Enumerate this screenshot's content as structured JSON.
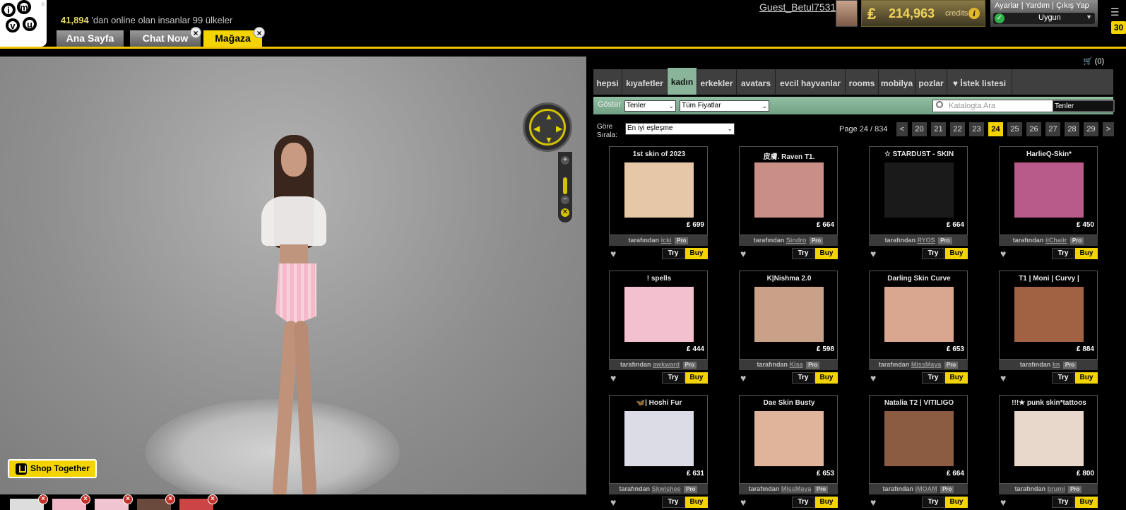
{
  "header": {
    "logo_letters": [
      "i",
      "m",
      "v",
      "u"
    ],
    "registered": "®",
    "online_count": "41,894",
    "online_text": " 'dan online olan insanlar 99 ülkeler",
    "username": "Guest_Betul7531",
    "credits_symbol": "₤",
    "credits_amount": "214,963",
    "credits_label": "credits",
    "info_glyph": "i",
    "links": [
      "Ayarlar",
      "Yardım",
      "Çıkış Yap"
    ],
    "link_separator": "|",
    "status": "Uygun",
    "menu_count": "30",
    "tabs": [
      {
        "label": "Ana Sayfa",
        "closable": false,
        "active": false
      },
      {
        "label": "Chat Now",
        "closable": true,
        "active": false
      },
      {
        "label": "Mağaza",
        "closable": true,
        "active": true
      }
    ],
    "close_glyph": "×"
  },
  "scene": {
    "shop_together_label": "Shop Together",
    "zoom_in": "+",
    "zoom_out": "−"
  },
  "cart": {
    "label": "(0)"
  },
  "catalog": {
    "tabs": [
      "hepsi",
      "kıyafetler",
      "kadın",
      "erkekler",
      "avatars",
      "evcil hayvanlar",
      "rooms",
      "mobilya",
      "pozlar",
      "İstek listesi"
    ],
    "active_tab": "kadın",
    "filter": {
      "show_label": "Göster",
      "gender_value": "Tenler",
      "price_value": "Tüm Fiyatlar",
      "search_placeholder": "Katalogta Ara",
      "search_scope": "Tenler"
    },
    "sort": {
      "label": "Göre Sırala:",
      "value": "En iyi eşleşme"
    },
    "pagination": {
      "label": "Page 24 / 834",
      "prev": "<",
      "next": ">",
      "pages": [
        "20",
        "21",
        "22",
        "23",
        "24",
        "25",
        "26",
        "27",
        "28",
        "29"
      ],
      "current": "24"
    },
    "by_label": "tarafından",
    "pro_label": "Pro",
    "try_label": "Try",
    "buy_label": "Buy",
    "currency_symbol": "₤",
    "items": [
      {
        "title": "1st skin of 2023",
        "price": "699",
        "author": "icki",
        "img": "#e6c8a8"
      },
      {
        "title": "皮膚. Raven T1.",
        "price": "664",
        "author": "Sindro",
        "img": "#c98f86"
      },
      {
        "title": "☆ STARDUST - SKIN",
        "price": "664",
        "author": "RYOS",
        "img": "#1a1a1a"
      },
      {
        "title": "HarlieQ-Skin*",
        "price": "450",
        "author": "iiChaiir",
        "img": "#b85a8a"
      },
      {
        "title": "! spells",
        "price": "444",
        "author": "awkward",
        "img": "#f2c0cf"
      },
      {
        "title": "K|Nishma 2.0",
        "price": "598",
        "author": "Kisa",
        "img": "#c9a088"
      },
      {
        "title": "Darling Skin Curve",
        "price": "653",
        "author": "MissMaya",
        "img": "#d9a68f"
      },
      {
        "title": "T1 | Moni | Curvy |",
        "price": "884",
        "author": "kn",
        "img": "#a06242"
      },
      {
        "title": "🦋| Hoshi Fur",
        "price": "631",
        "author": "Skwishee",
        "img": "#dcdce6"
      },
      {
        "title": "Dae Skin Busty",
        "price": "653",
        "author": "MissMaya",
        "img": "#e0b39b"
      },
      {
        "title": "Natalia T2 | VITILIGO",
        "price": "664",
        "author": "iMOAM",
        "img": "#8b5b42"
      },
      {
        "title": "!!!★ punk skin*tattoos",
        "price": "800",
        "author": "brumi",
        "img": "#e8d8cc"
      }
    ]
  }
}
